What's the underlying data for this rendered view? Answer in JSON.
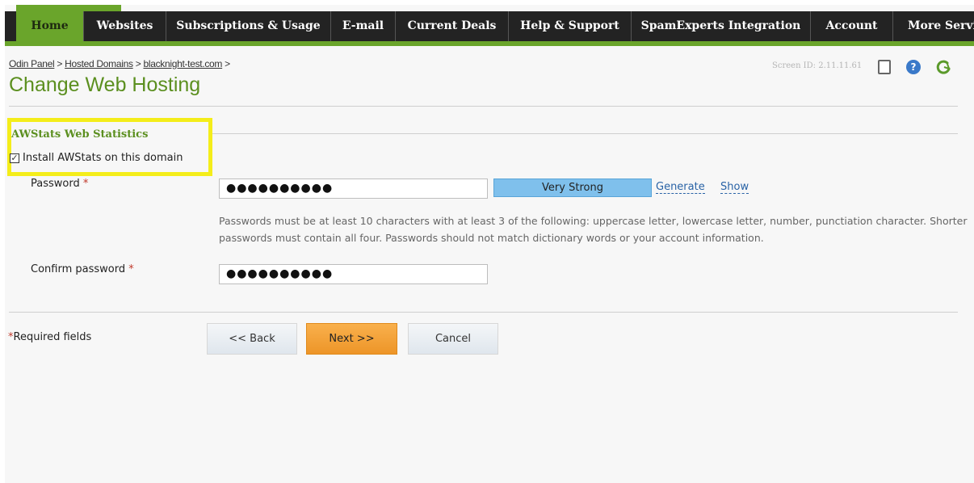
{
  "nav": {
    "items": [
      "Home",
      "Websites",
      "Subscriptions & Usage",
      "E-mail",
      "Current Deals",
      "Help & Support",
      "SpamExperts Integration",
      "Account",
      "More Servi"
    ]
  },
  "breadcrumb": {
    "items": [
      "Odin Panel",
      "Hosted Domains",
      "blacknight-test.com"
    ],
    "separator": " > "
  },
  "page": {
    "title": "Change Web Hosting",
    "screen_id": "Screen ID: 2.11.11.61"
  },
  "awstats": {
    "section_title": "AWStats Web Statistics",
    "install_label": "Install AWStats on this domain",
    "install_checked": true
  },
  "form": {
    "password_label": "Password",
    "password_value": "●●●●●●●●●●",
    "strength": "Very Strong",
    "generate_label": "Generate",
    "show_label": "Show",
    "hint": "Passwords must be at least 10 characters with at least 3 of the following: uppercase letter, lowercase letter, number, punctiation character. Shorter passwords must contain all four. Passwords should not match dictionary words or your account information.",
    "confirm_label": "Confirm password",
    "confirm_value": "●●●●●●●●●●",
    "required_marker": "*"
  },
  "footer": {
    "required_note": "Required fields",
    "back_label": "<< Back",
    "next_label": "Next >>",
    "cancel_label": "Cancel"
  },
  "colors": {
    "brand_green": "#6aa52b",
    "title_green": "#5b8f1f",
    "highlight": "#f4ed1a",
    "strength_bar": "#7fc0ec",
    "next_button": "#ed9528"
  }
}
